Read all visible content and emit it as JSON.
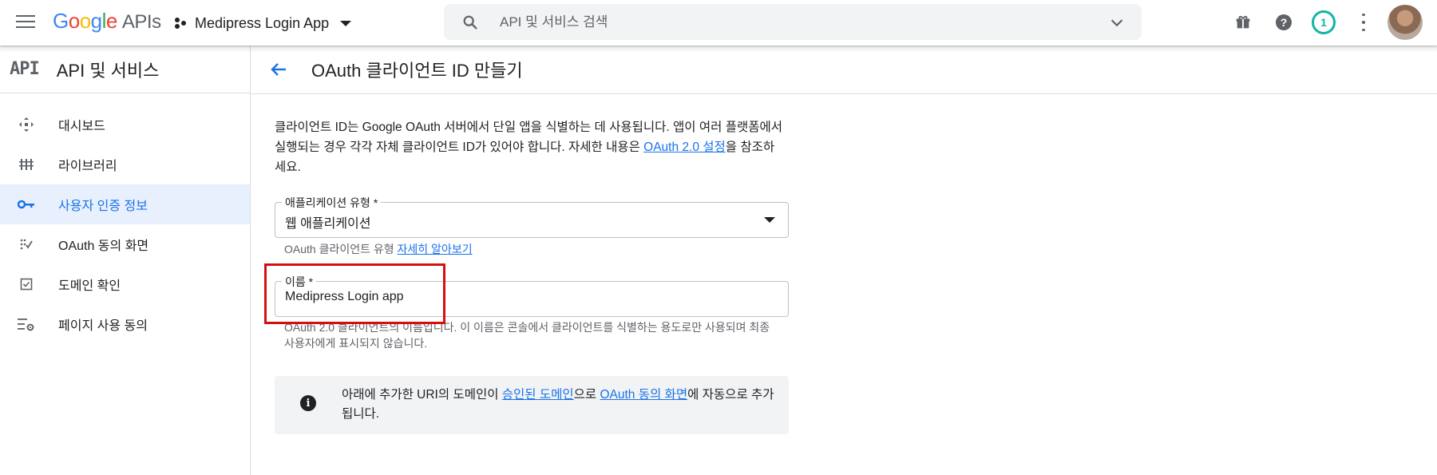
{
  "topbar": {
    "logo_google": "Google",
    "logo_apis": "APIs",
    "project_name": "Medipress Login App",
    "search_placeholder": "API 및 서비스 검색",
    "notification_count": "1"
  },
  "icons": {
    "menu": "menu-icon",
    "search": "search-icon",
    "gift": "gift-icon",
    "help": "help-icon",
    "more": "more-vert-icon"
  },
  "sidebar": {
    "api_logo": "API",
    "title": "API 및 서비스",
    "items": [
      {
        "label": "대시보드",
        "icon": "dashboard-icon"
      },
      {
        "label": "라이브러리",
        "icon": "library-icon"
      },
      {
        "label": "사용자 인증 정보",
        "icon": "key-icon",
        "active": true
      },
      {
        "label": "OAuth 동의 화면",
        "icon": "consent-icon"
      },
      {
        "label": "도메인 확인",
        "icon": "checkbox-icon"
      },
      {
        "label": "페이지 사용 동의",
        "icon": "settings-list-icon"
      }
    ]
  },
  "page": {
    "title": "OAuth 클라이언트 ID 만들기",
    "description_part1": "클라이언트 ID는 Google OAuth 서버에서 단일 앱을 식별하는 데 사용됩니다. 앱이 여러 플랫폼에서 실행되는 경우 각각 자체 클라이언트 ID가 있어야 합니다. 자세한 내용은 ",
    "description_link": "OAuth 2.0 설정",
    "description_part2": "을 참조하세요."
  },
  "form": {
    "app_type_label": "애플리케이션 유형 *",
    "app_type_value": "웹 애플리케이션",
    "app_type_hint": "OAuth 클라이언트 유형 ",
    "app_type_hint_link": "자세히 알아보기",
    "name_label": "이름 *",
    "name_value": "Medipress Login app",
    "name_hint": "OAuth 2.0 클라이언트의 이름입니다. 이 이름은 콘솔에서 클라이언트를 식별하는 용도로만 사용되며 최종 사용자에게 표시되지 않습니다."
  },
  "info": {
    "text_part1": "아래에 추가한 URI의 도메인이 ",
    "link1": "승인된 도메인",
    "text_part2": "으로 ",
    "link2": "OAuth 동의 화면",
    "text_part3": "에 자동으로 추가됩니다."
  },
  "colors": {
    "accent": "#1a73e8",
    "active_bg": "#e8f0fe",
    "highlight": "#d31010",
    "notification": "#12b5a6"
  }
}
